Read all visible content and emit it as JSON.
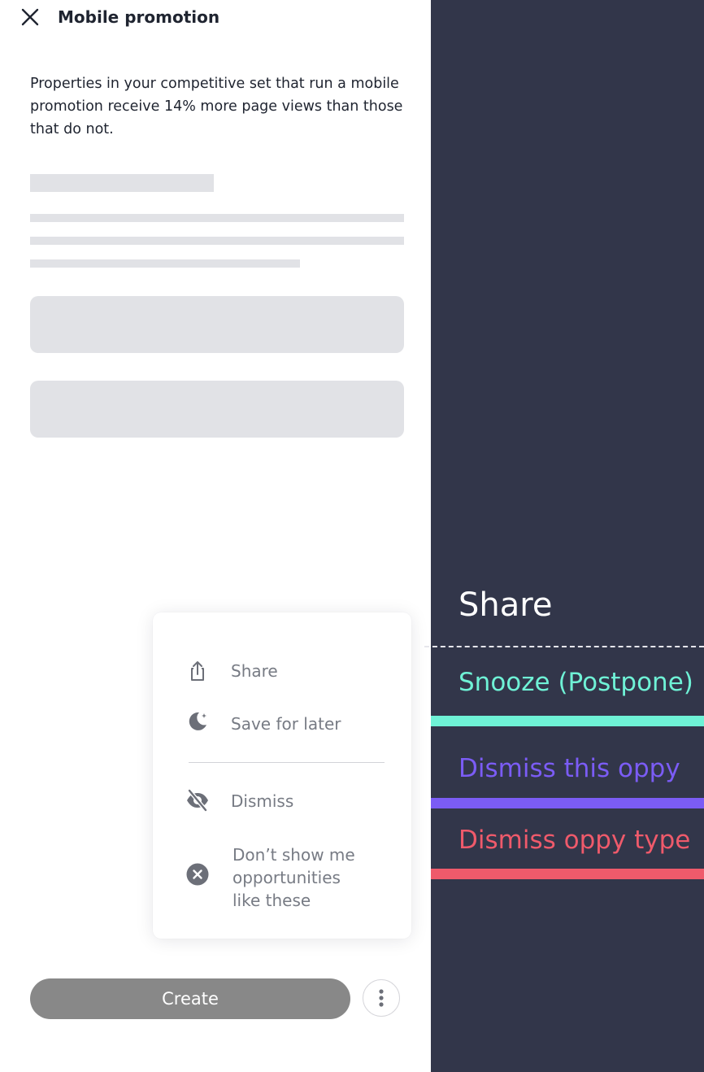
{
  "panel": {
    "title": "Mobile promotion",
    "description": "Properties in your competitive set that run a mobile promotion receive 14% more page views than those that do not."
  },
  "menu": {
    "items": [
      {
        "label": "Share",
        "icon": "share-icon"
      },
      {
        "label": "Save for later",
        "icon": "moon-icon"
      },
      {
        "label": "Dismiss",
        "icon": "eye-off-icon"
      },
      {
        "label": "Don’t show me\nopportunities\nlike these",
        "icon": "close-circle-icon"
      }
    ]
  },
  "actions": {
    "create_label": "Create",
    "more_icon": "vertical-dots-icon"
  },
  "annotations": {
    "share": "Share",
    "snooze": "Snooze (Postpone)",
    "dismiss_this": "Dismiss this oppy",
    "dismiss_type": "Dismiss oppy type",
    "colors": {
      "background": "#32364a",
      "snooze": "#6ff2d6",
      "dismiss_this": "#7b5cf5",
      "dismiss_type": "#ef5a6b"
    }
  }
}
